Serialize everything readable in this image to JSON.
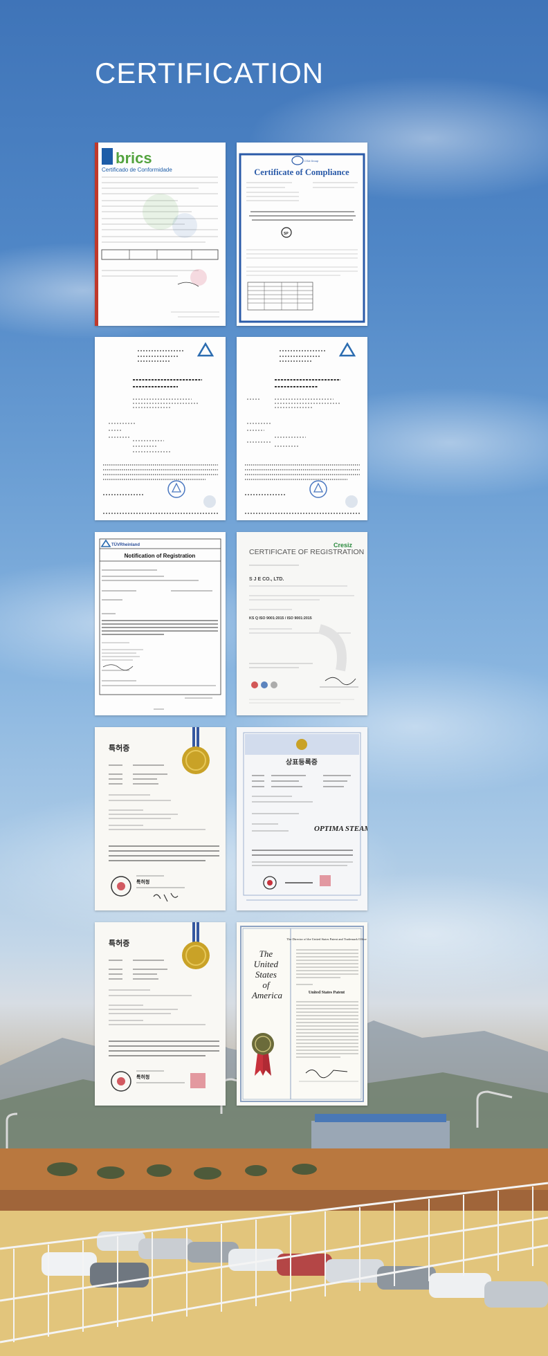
{
  "page": {
    "title": "CERTIFICATION"
  },
  "certificates": [
    {
      "id": "bric",
      "logo": "brics",
      "heading": "Certificado de Conformidade"
    },
    {
      "id": "csa",
      "logo": "CSA Group",
      "heading": "Certificate of Compliance"
    },
    {
      "id": "tuv-a",
      "logo": "delta-mark"
    },
    {
      "id": "tuv-b",
      "logo": "delta-mark"
    },
    {
      "id": "tuv-notification",
      "logo": "TÜVRheinland",
      "heading": "Notification of Registration"
    },
    {
      "id": "sje",
      "logo": "Cresiz",
      "heading": "CERTIFICATE OF REGISTRATION",
      "company": "S J E CO., LTD.",
      "standard": "KS Q ISO 9001:2015 / ISO 9001:2015"
    },
    {
      "id": "patent-kr-1",
      "heading": "특허증",
      "office": "특허청"
    },
    {
      "id": "trademark-kr",
      "heading": "상표등록증",
      "mark": "OPTIMA STEAMER"
    },
    {
      "id": "patent-kr-2",
      "heading": "특허증",
      "office": "특허청"
    },
    {
      "id": "us-patent",
      "heading_lines": [
        "The",
        "United",
        "States",
        "of",
        "America"
      ],
      "subheading": "The Director of the United States Patent and Trademark Office",
      "title_text": "United States Patent"
    }
  ],
  "colors": {
    "accent_blue": "#2b4f9a",
    "csa_blue": "#2a5aa8",
    "brics_green": "#53a33f",
    "brics_blue": "#1d5da8",
    "seal_gold": "#c9a227",
    "ribbon_red": "#c8323c"
  }
}
